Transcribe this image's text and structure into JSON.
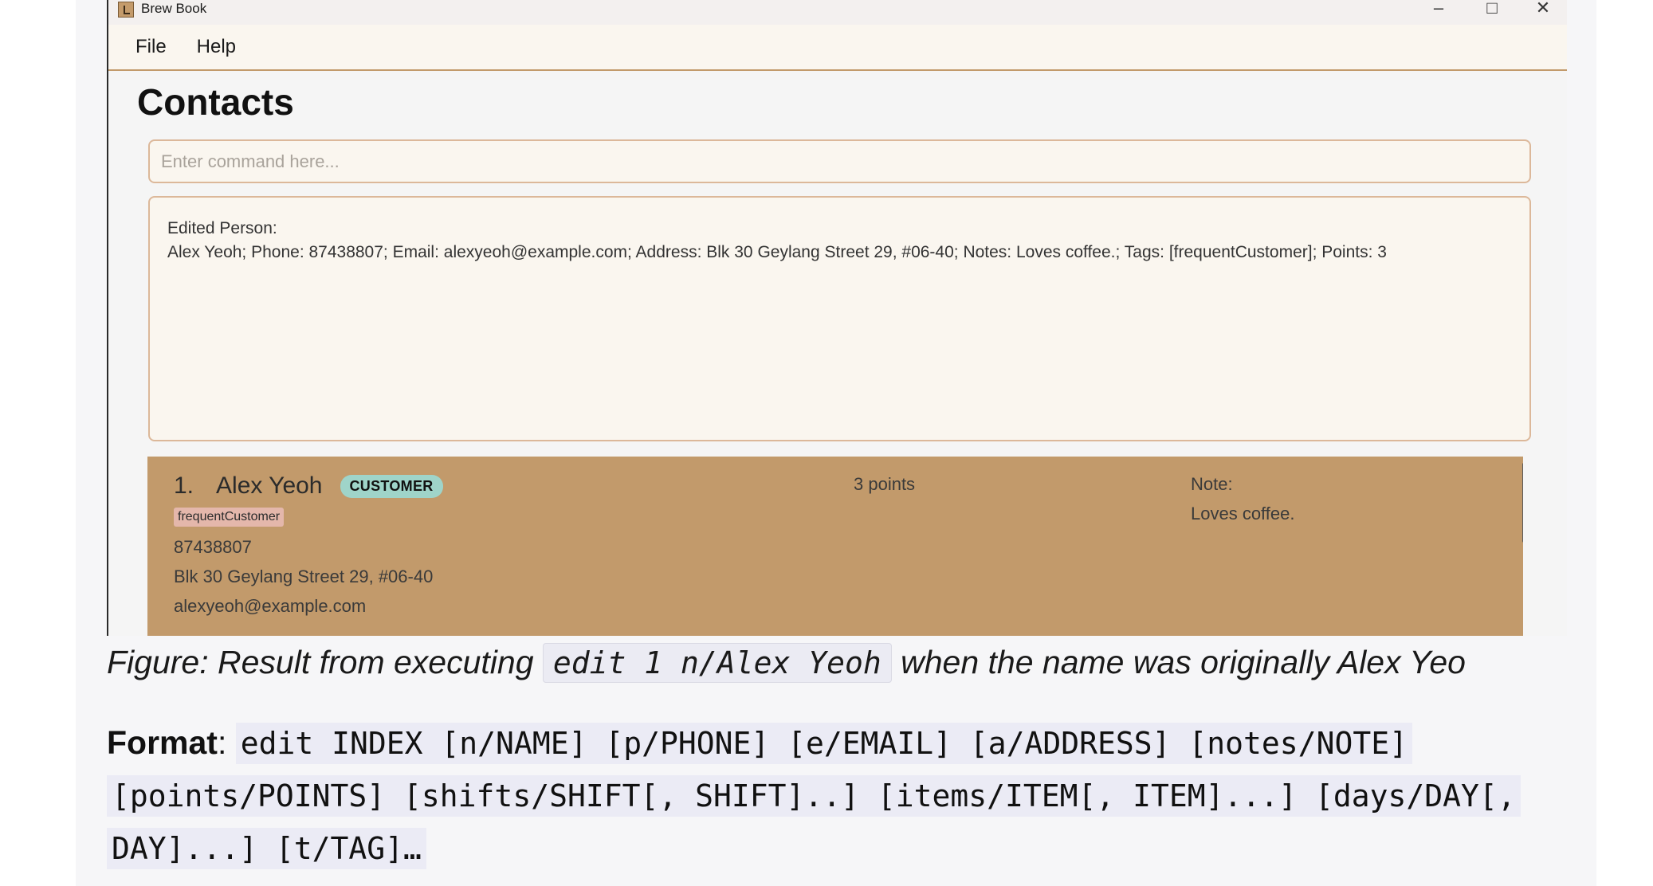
{
  "window": {
    "title": "Brew Book",
    "minimize_icon": "–",
    "maximize_icon": "□",
    "close_icon": "✕"
  },
  "menu": {
    "items": [
      "File",
      "Help"
    ]
  },
  "page_title": "Contacts",
  "command_box": {
    "placeholder": "Enter command here...",
    "value": ""
  },
  "result_display": {
    "line1": "Edited Person:",
    "line2": "Alex Yeoh; Phone: 87438807; Email: alexyeoh@example.com; Address: Blk 30 Geylang Street 29, #06-40; Notes: Loves coffee.; Tags: [frequentCustomer]; Points: 3"
  },
  "person_card": {
    "index": "1.",
    "name": "Alex Yeoh",
    "role": "CUSTOMER",
    "tag": "frequentCustomer",
    "phone": "87438807",
    "address": "Blk 30 Geylang Street 29, #06-40",
    "email": "alexyeoh@example.com",
    "points": "3 points",
    "note_label": "Note:",
    "note_text": "Loves coffee."
  },
  "colors": {
    "card_background": "#c29a6b",
    "role_badge": "#9fd4c9",
    "tag_badge": "#e4b7ab",
    "input_border": "#dcb89a"
  },
  "doc": {
    "caption_prefix": "Figure: Result from executing ",
    "caption_code": "edit 1 n/Alex Yeoh",
    "caption_suffix": " when the name was originally Alex Yeo",
    "format_label": "Format",
    "format_colon": ": ",
    "format_code": "edit INDEX [n/NAME] [p/PHONE] [e/EMAIL] [a/ADDRESS] [notes/NOTE] [points/POINTS] [shifts/SHIFT[, SHIFT]..] [items/ITEM[, ITEM]...] [days/DAY[, DAY]...] [t/TAG]…"
  }
}
